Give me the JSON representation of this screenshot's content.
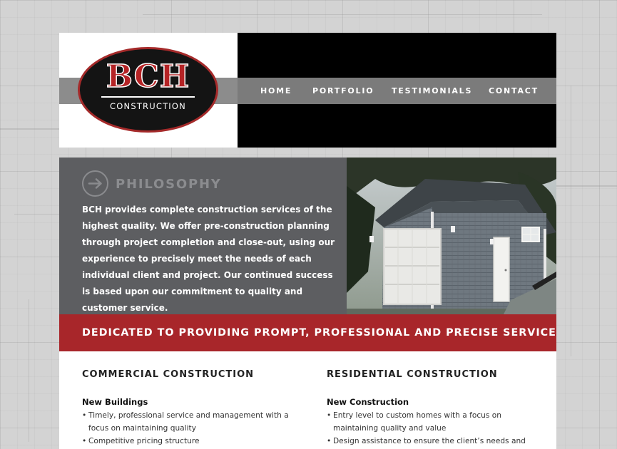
{
  "logo": {
    "title": "BCH",
    "subtitle": "CONSTRUCTION"
  },
  "nav": {
    "items": [
      {
        "label": "HOME"
      },
      {
        "label": "PORTFOLIO"
      },
      {
        "label": "TESTIMONIALS"
      },
      {
        "label": "CONTACT"
      }
    ]
  },
  "philosophy": {
    "heading": "PHILOSOPHY",
    "body": "BCH provides complete construction services of the highest quality. We offer pre-construction planning through project completion and close-out, using our experience to precisely meet the needs of each individual client and project. Our continued success is based upon our commitment to quality and customer service."
  },
  "banner": {
    "text": "DEDICATED TO PROVIDING PROMPT, PROFESSIONAL AND PRECISE SERVICE"
  },
  "services": {
    "commercial": {
      "heading": "COMMERCIAL CONSTRUCTION",
      "subheading": "New Buildings",
      "bullets": [
        "Timely, professional service and management with a focus on maintaining quality",
        "Competitive pricing structure"
      ]
    },
    "residential": {
      "heading": "RESIDENTIAL CONSTRUCTION",
      "subheading": "New Construction",
      "bullets": [
        "Entry level to custom homes with a focus on maintaining quality and value",
        "Design assistance to ensure the client’s needs and"
      ]
    }
  },
  "colors": {
    "brand_red": "#a8262a",
    "panel_gray": "#5d5e61",
    "nav_gray": "#7b7b7b",
    "header_black": "#000000"
  },
  "icons": {
    "philosophy": "arrow-right-circle-icon"
  }
}
